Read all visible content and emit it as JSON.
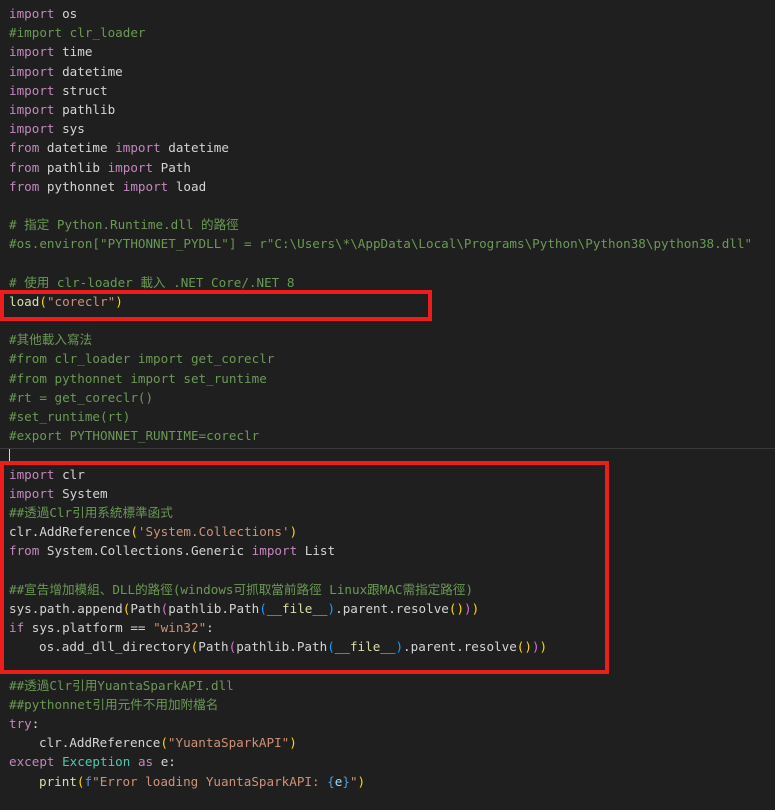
{
  "code": {
    "lines": [
      {
        "indent": false,
        "tokens": [
          {
            "t": "import",
            "c": "kw"
          },
          {
            "t": " os",
            "c": "id"
          }
        ]
      },
      {
        "indent": false,
        "tokens": [
          {
            "t": "#import clr_loader",
            "c": "cm"
          }
        ]
      },
      {
        "indent": false,
        "tokens": [
          {
            "t": "import",
            "c": "kw"
          },
          {
            "t": " time",
            "c": "id"
          }
        ]
      },
      {
        "indent": false,
        "tokens": [
          {
            "t": "import",
            "c": "kw"
          },
          {
            "t": " datetime",
            "c": "id"
          }
        ]
      },
      {
        "indent": false,
        "tokens": [
          {
            "t": "import",
            "c": "kw"
          },
          {
            "t": " struct",
            "c": "id"
          }
        ]
      },
      {
        "indent": false,
        "tokens": [
          {
            "t": "import",
            "c": "kw"
          },
          {
            "t": " pathlib",
            "c": "id"
          }
        ]
      },
      {
        "indent": false,
        "tokens": [
          {
            "t": "import",
            "c": "kw"
          },
          {
            "t": " sys",
            "c": "id"
          }
        ]
      },
      {
        "indent": false,
        "tokens": [
          {
            "t": "from",
            "c": "kw"
          },
          {
            "t": " datetime ",
            "c": "id"
          },
          {
            "t": "import",
            "c": "kw"
          },
          {
            "t": " datetime",
            "c": "id"
          }
        ]
      },
      {
        "indent": false,
        "tokens": [
          {
            "t": "from",
            "c": "kw"
          },
          {
            "t": " pathlib ",
            "c": "id"
          },
          {
            "t": "import",
            "c": "kw"
          },
          {
            "t": " Path",
            "c": "id"
          }
        ]
      },
      {
        "indent": false,
        "tokens": [
          {
            "t": "from",
            "c": "kw"
          },
          {
            "t": " pythonnet ",
            "c": "id"
          },
          {
            "t": "import",
            "c": "kw"
          },
          {
            "t": " load",
            "c": "id"
          }
        ]
      },
      {
        "indent": false,
        "tokens": []
      },
      {
        "indent": false,
        "tokens": [
          {
            "t": "# 指定 Python.Runtime.dll 的路徑",
            "c": "cm"
          }
        ]
      },
      {
        "indent": false,
        "tokens": [
          {
            "t": "#os.environ[\"PYTHONNET_PYDLL\"] = r\"C:\\Users\\*\\AppData\\Local\\Programs\\Python\\Python38\\python38.dll\"",
            "c": "cm"
          }
        ]
      },
      {
        "indent": false,
        "tokens": []
      },
      {
        "indent": false,
        "tokens": [
          {
            "t": "# 使用 clr-loader 載入 .NET Core/.NET 8",
            "c": "cm"
          }
        ]
      },
      {
        "indent": false,
        "tokens": [
          {
            "t": "load",
            "c": "fn"
          },
          {
            "t": "(",
            "c": "br1"
          },
          {
            "t": "\"coreclr\"",
            "c": "str"
          },
          {
            "t": ")",
            "c": "br1"
          }
        ]
      },
      {
        "indent": false,
        "tokens": []
      },
      {
        "indent": false,
        "tokens": [
          {
            "t": "#其他載入寫法",
            "c": "cm"
          }
        ]
      },
      {
        "indent": false,
        "tokens": [
          {
            "t": "#from clr_loader import get_coreclr",
            "c": "cm"
          }
        ]
      },
      {
        "indent": false,
        "tokens": [
          {
            "t": "#from pythonnet import set_runtime",
            "c": "cm"
          }
        ]
      },
      {
        "indent": false,
        "tokens": [
          {
            "t": "#rt = get_coreclr()",
            "c": "cm"
          }
        ]
      },
      {
        "indent": false,
        "tokens": [
          {
            "t": "#set_runtime(rt)",
            "c": "cm"
          }
        ]
      },
      {
        "indent": false,
        "tokens": [
          {
            "t": "#export PYTHONNET_RUNTIME=coreclr",
            "c": "cm"
          }
        ]
      },
      {
        "indent": false,
        "tokens": []
      },
      {
        "indent": false,
        "tokens": [
          {
            "t": "import",
            "c": "kw"
          },
          {
            "t": " clr",
            "c": "id"
          }
        ]
      },
      {
        "indent": false,
        "tokens": [
          {
            "t": "import",
            "c": "kw"
          },
          {
            "t": " System",
            "c": "id"
          }
        ]
      },
      {
        "indent": false,
        "tokens": [
          {
            "t": "##透過Clr引用系統標準函式",
            "c": "cm"
          }
        ]
      },
      {
        "indent": false,
        "tokens": [
          {
            "t": "clr.AddReference",
            "c": "id"
          },
          {
            "t": "(",
            "c": "br1"
          },
          {
            "t": "'System.Collections'",
            "c": "str"
          },
          {
            "t": ")",
            "c": "br1"
          }
        ]
      },
      {
        "indent": false,
        "tokens": [
          {
            "t": "from",
            "c": "kw"
          },
          {
            "t": " System.Collections.Generic ",
            "c": "id"
          },
          {
            "t": "import",
            "c": "kw"
          },
          {
            "t": " List",
            "c": "id"
          }
        ]
      },
      {
        "indent": false,
        "tokens": []
      },
      {
        "indent": false,
        "tokens": [
          {
            "t": "##宣告增加模組、DLL的路徑(windows可抓取當前路徑 Linux跟MAC需指定路徑)",
            "c": "cm"
          }
        ]
      },
      {
        "indent": false,
        "tokens": [
          {
            "t": "sys.path.append",
            "c": "id"
          },
          {
            "t": "(",
            "c": "br1"
          },
          {
            "t": "Path",
            "c": "id"
          },
          {
            "t": "(",
            "c": "br2"
          },
          {
            "t": "pathlib.Path",
            "c": "id"
          },
          {
            "t": "(",
            "c": "br3"
          },
          {
            "t": "__file__",
            "c": "fn"
          },
          {
            "t": ")",
            "c": "br3"
          },
          {
            "t": ".parent.resolve",
            "c": "id"
          },
          {
            "t": "()",
            "c": "br1"
          },
          {
            "t": ")",
            "c": "br2"
          },
          {
            "t": ")",
            "c": "br1"
          }
        ]
      },
      {
        "indent": false,
        "tokens": [
          {
            "t": "if",
            "c": "kw"
          },
          {
            "t": " sys.platform ",
            "c": "id"
          },
          {
            "t": "==",
            "c": "id"
          },
          {
            "t": " ",
            "c": "id"
          },
          {
            "t": "\"win32\"",
            "c": "str"
          },
          {
            "t": ":",
            "c": "id"
          }
        ]
      },
      {
        "indent": true,
        "tokens": [
          {
            "t": "os.add_dll_directory",
            "c": "id"
          },
          {
            "t": "(",
            "c": "br1"
          },
          {
            "t": "Path",
            "c": "id"
          },
          {
            "t": "(",
            "c": "br2"
          },
          {
            "t": "pathlib.Path",
            "c": "id"
          },
          {
            "t": "(",
            "c": "br3"
          },
          {
            "t": "__file__",
            "c": "fn"
          },
          {
            "t": ")",
            "c": "br3"
          },
          {
            "t": ".parent.resolve",
            "c": "id"
          },
          {
            "t": "()",
            "c": "br1"
          },
          {
            "t": ")",
            "c": "br2"
          },
          {
            "t": ")",
            "c": "br1"
          }
        ]
      },
      {
        "indent": false,
        "tokens": []
      },
      {
        "indent": false,
        "tokens": [
          {
            "t": "##透過Clr引用YuantaSparkAPI.dll",
            "c": "cm"
          }
        ]
      },
      {
        "indent": false,
        "tokens": [
          {
            "t": "##pythonnet引用元件不用加附檔名",
            "c": "cm"
          }
        ]
      },
      {
        "indent": false,
        "tokens": [
          {
            "t": "try",
            "c": "kw"
          },
          {
            "t": ":",
            "c": "id"
          }
        ]
      },
      {
        "indent": true,
        "tokens": [
          {
            "t": "clr.AddReference",
            "c": "id"
          },
          {
            "t": "(",
            "c": "br1"
          },
          {
            "t": "\"YuantaSparkAPI\"",
            "c": "str"
          },
          {
            "t": ")",
            "c": "br1"
          }
        ]
      },
      {
        "indent": false,
        "tokens": [
          {
            "t": "except",
            "c": "kw"
          },
          {
            "t": " ",
            "c": "id"
          },
          {
            "t": "Exception",
            "c": "cls"
          },
          {
            "t": " ",
            "c": "id"
          },
          {
            "t": "as",
            "c": "kw"
          },
          {
            "t": " e:",
            "c": "id"
          }
        ]
      },
      {
        "indent": true,
        "tokens": [
          {
            "t": "print",
            "c": "fn"
          },
          {
            "t": "(",
            "c": "br1"
          },
          {
            "t": "f",
            "c": "blue"
          },
          {
            "t": "\"Error loading YuantaSparkAPI: ",
            "c": "str"
          },
          {
            "t": "{",
            "c": "blue"
          },
          {
            "t": "e",
            "c": "var"
          },
          {
            "t": "}",
            "c": "blue"
          },
          {
            "t": "\"",
            "c": "str"
          },
          {
            "t": ")",
            "c": "br1"
          }
        ]
      }
    ]
  }
}
